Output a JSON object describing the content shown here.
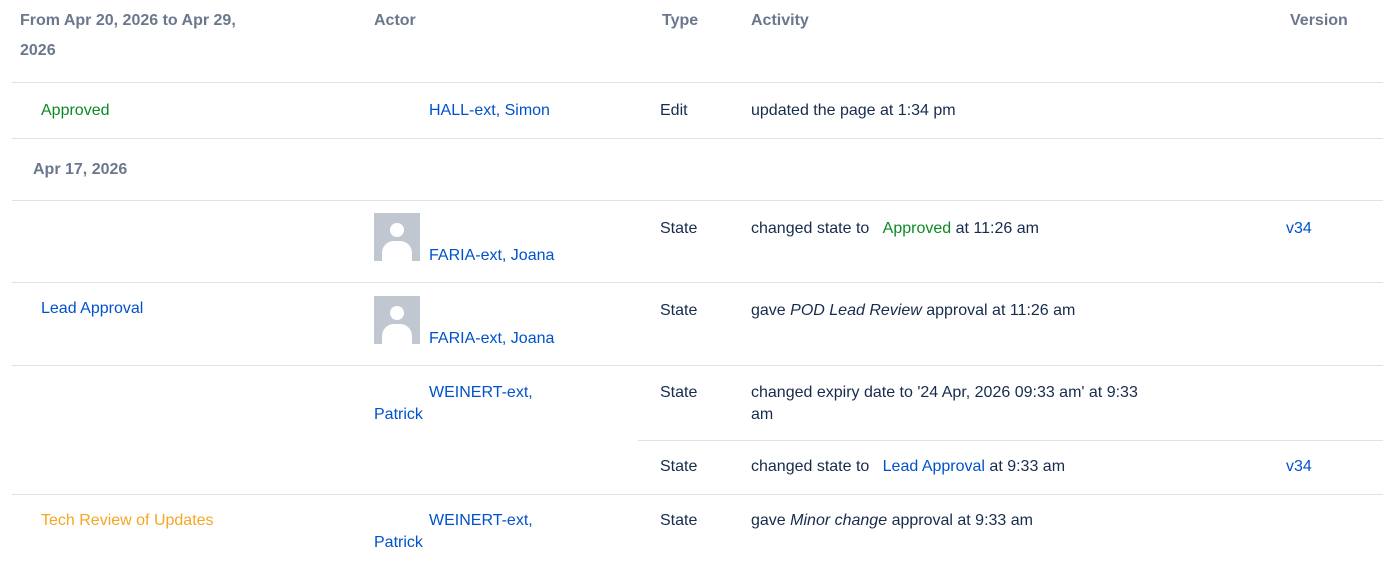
{
  "header": {
    "date_range": "From Apr 20, 2026 to Apr 29,",
    "date_range_line2": "2026",
    "actor": "Actor",
    "type": "Type",
    "activity": "Activity",
    "version": "Version"
  },
  "groups": {
    "second_date": "Apr 17, 2026"
  },
  "rows": [
    {
      "workflow_state": "Approved",
      "actor": "HALL-ext, Simon",
      "type": "Edit",
      "activity": "updated the page at 1:34 pm"
    },
    {
      "workflow_state": "",
      "actor": "FARIA-ext, Joana",
      "type": "State",
      "activity_prefix": "changed state to",
      "activity_state": "Approved",
      "activity_suffix": "at 11:26 am",
      "version": "v34"
    },
    {
      "workflow_state": "Lead Approval",
      "actor": "FARIA-ext, Joana",
      "type": "State",
      "activity_prefix": "gave",
      "activity_em": "POD Lead Review",
      "activity_suffix": "approval at 11:26 am"
    },
    {
      "actor_line1": "WEINERT-ext,",
      "actor_line2": "Patrick",
      "type": "State",
      "activity_line1": "changed expiry date to '24 Apr, 2026 09:33 am' at 9:33",
      "activity_line2": "am"
    },
    {
      "type": "State",
      "activity_prefix": "changed state to",
      "activity_state": "Lead Approval",
      "activity_suffix": "at 9:33 am",
      "version": "v34"
    },
    {
      "workflow_state": "Tech Review of Updates",
      "actor_line1": "WEINERT-ext,",
      "actor_line2": "Patrick",
      "type": "State",
      "activity_prefix": "gave",
      "activity_em": "Minor change",
      "activity_suffix": "approval at 9:33 am"
    }
  ],
  "icons": {
    "avatar": "default-user-avatar-icon"
  },
  "colors": {
    "link": "#0052cc",
    "approved": "#0b8a24",
    "tech_review": "#f5a623",
    "header_text": "#6b778c",
    "divider": "#dfe1e6"
  }
}
